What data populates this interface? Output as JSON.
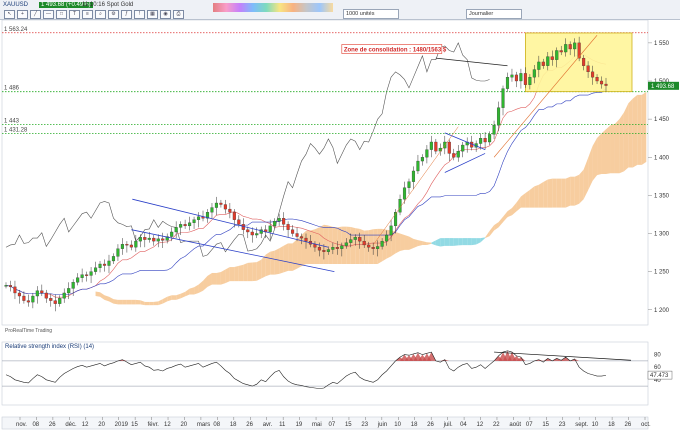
{
  "toolbar": {
    "title": "XAUUSD",
    "price": "1 493.68 (+0.49%)",
    "time": "11:10:16 Spot Gold",
    "period_select": "1000 unités",
    "interval_select": "Journalier"
  },
  "annotation": {
    "zone_label": "Zone de consolidation : 1480/1563 $"
  },
  "chart_data": {
    "type": "candlestick",
    "title": "",
    "indicators": [
      "Ichimoku",
      "RSI (14)"
    ],
    "y_right_ticks": [
      "1 550",
      "1 500",
      "1 450",
      "1 400",
      "1 350",
      "1 300",
      "1 250",
      "1 200"
    ],
    "ylim": [
      1180,
      1580
    ],
    "levels": [
      {
        "label": "1 563.24",
        "value": 1563.24,
        "color": "#d33",
        "style": "dotted"
      },
      {
        "label": "1 486",
        "value": 1486,
        "color": "#2a2",
        "style": "dotted"
      },
      {
        "label": "1 443",
        "value": 1443,
        "color": "#2a2",
        "style": "dotted"
      },
      {
        "label": "1 431.28",
        "value": 1431.28,
        "color": "#2a2",
        "style": "dotted"
      }
    ],
    "last_price_label": "1 493.68",
    "last_price_value": 1493.68,
    "x_tick_labels": [
      "nov.",
      "08",
      "26",
      "déc.",
      "12",
      "20",
      "2019",
      "15",
      "févr.",
      "12",
      "20",
      "mars",
      "08",
      "18",
      "26",
      "avr.",
      "11",
      "19",
      "mai",
      "07",
      "15",
      "23",
      "juin",
      "10",
      "18",
      "26",
      "juil.",
      "04",
      "12",
      "22",
      "août",
      "07",
      "15",
      "23",
      "sept.",
      "10",
      "18",
      "26",
      "oct."
    ],
    "close_series": [
      1232,
      1230,
      1222,
      1218,
      1212,
      1210,
      1218,
      1225,
      1222,
      1215,
      1212,
      1208,
      1215,
      1222,
      1228,
      1236,
      1242,
      1246,
      1245,
      1250,
      1255,
      1260,
      1258,
      1264,
      1270,
      1280,
      1286,
      1285,
      1282,
      1290,
      1295,
      1292,
      1294,
      1290,
      1293,
      1291,
      1296,
      1302,
      1308,
      1312,
      1310,
      1314,
      1318,
      1322,
      1320,
      1328,
      1334,
      1340,
      1338,
      1332,
      1328,
      1318,
      1312,
      1305,
      1302,
      1298,
      1300,
      1305,
      1302,
      1310,
      1316,
      1320,
      1312,
      1305,
      1300,
      1296,
      1294,
      1290,
      1286,
      1282,
      1278,
      1276,
      1279,
      1282,
      1280,
      1284,
      1288,
      1292,
      1295,
      1290,
      1285,
      1282,
      1280,
      1283,
      1290,
      1298,
      1310,
      1328,
      1345,
      1360,
      1368,
      1382,
      1395,
      1400,
      1410,
      1420,
      1408,
      1412,
      1420,
      1405,
      1400,
      1408,
      1416,
      1420,
      1413,
      1418,
      1425,
      1420,
      1430,
      1442,
      1465,
      1490,
      1505,
      1508,
      1500,
      1510,
      1495,
      1505,
      1515,
      1525,
      1520,
      1532,
      1528,
      1540,
      1538,
      1548,
      1542,
      1550,
      1530,
      1520,
      1512,
      1505,
      1500,
      1496,
      1494
    ],
    "rsi": {
      "name": "Relative strength index (RSI) (14)",
      "ylim": [
        0,
        100
      ],
      "levels": [
        70,
        30
      ],
      "tick_labels": [
        "80",
        "60",
        "40"
      ],
      "last_label": "47.473",
      "last_value": 47.47,
      "values": [
        48,
        45,
        40,
        38,
        36,
        35,
        42,
        48,
        45,
        40,
        38,
        36,
        44,
        50,
        54,
        58,
        61,
        63,
        60,
        62,
        64,
        66,
        62,
        65,
        67,
        70,
        72,
        68,
        64,
        66,
        68,
        62,
        60,
        55,
        56,
        54,
        58,
        60,
        63,
        65,
        60,
        62,
        64,
        66,
        60,
        63,
        66,
        68,
        62,
        55,
        50,
        42,
        38,
        34,
        32,
        30,
        33,
        40,
        37,
        45,
        52,
        55,
        45,
        38,
        34,
        32,
        31,
        29,
        28,
        27,
        26,
        27,
        32,
        36,
        34,
        40,
        46,
        50,
        52,
        44,
        40,
        38,
        36,
        40,
        48,
        54,
        62,
        70,
        76,
        80,
        79,
        81,
        83,
        80,
        82,
        84,
        70,
        68,
        72,
        58,
        54,
        60,
        64,
        66,
        58,
        60,
        64,
        58,
        64,
        70,
        78,
        84,
        86,
        84,
        78,
        76,
        64,
        66,
        70,
        72,
        68,
        74,
        70,
        74,
        71,
        76,
        70,
        73,
        60,
        54,
        50,
        48,
        46,
        46,
        47
      ]
    },
    "legend": "ProRealTime Trading"
  }
}
